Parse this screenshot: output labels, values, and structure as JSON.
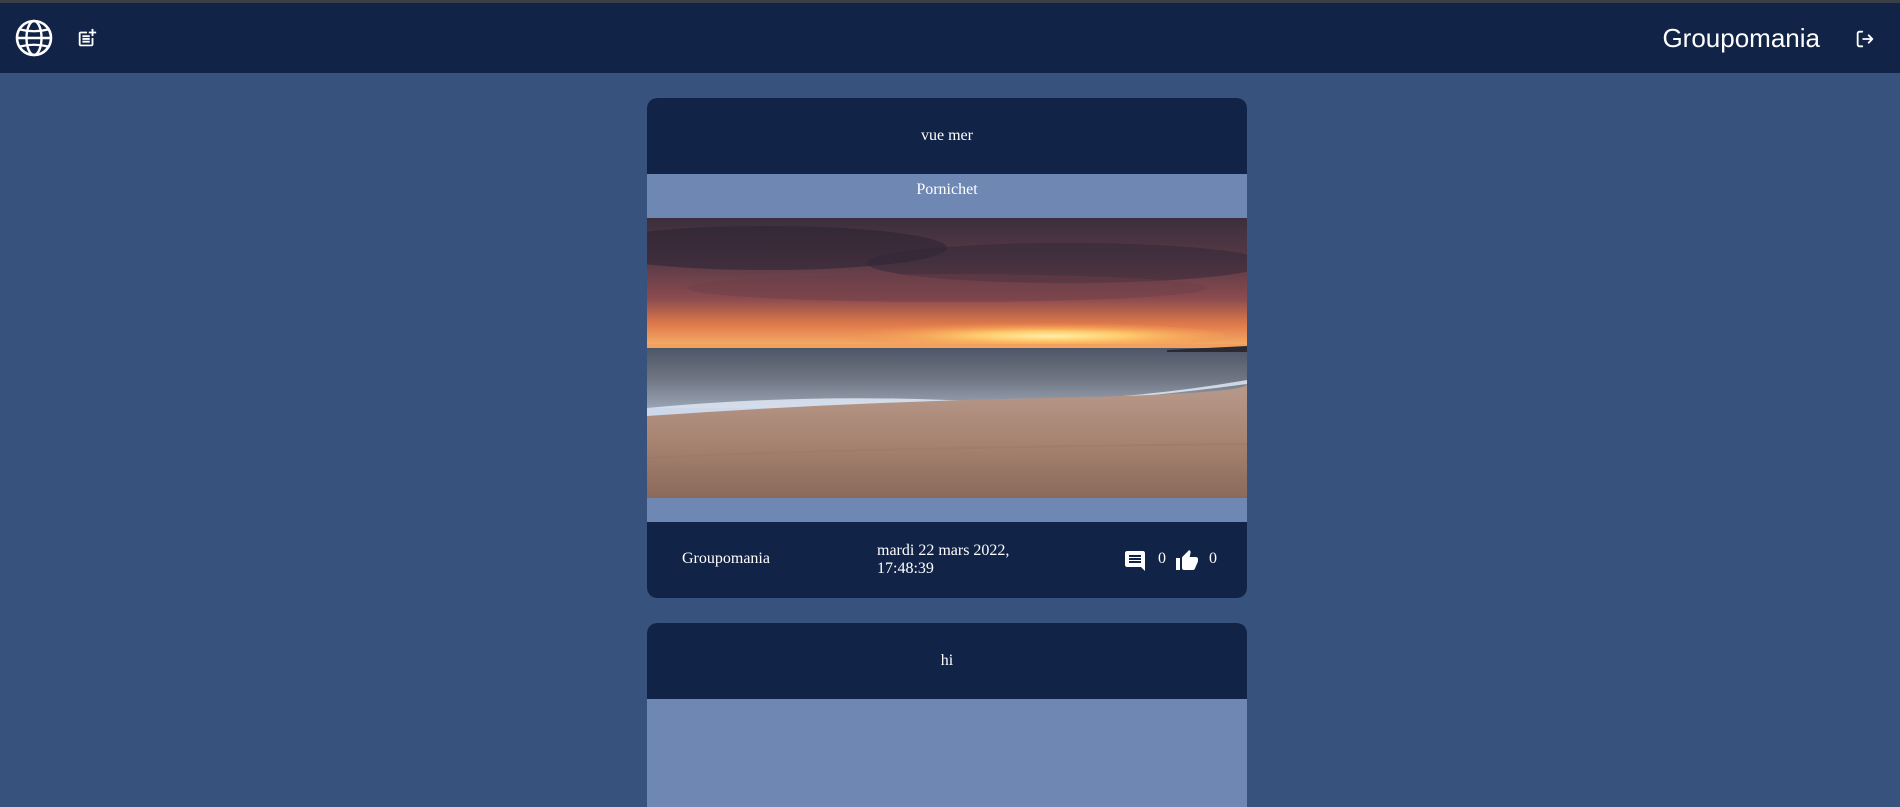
{
  "navbar": {
    "home_icon": "globe-icon",
    "new_post_icon": "post-add-icon",
    "brand": "Groupomania",
    "logout_icon": "logout-icon"
  },
  "posts": [
    {
      "title": "vue mer",
      "description": "Pornichet",
      "image": "sunset-beach-photo",
      "author": "Groupomania",
      "date": "mardi 22 mars 2022, 17:48:39",
      "comment_icon": "comment-icon",
      "comments": "0",
      "like_icon": "thumb-up-icon",
      "likes": "0"
    },
    {
      "title": "hi"
    }
  ],
  "colors": {
    "background": "#37527d",
    "navbar": "#112347",
    "card_body": "#6e88b3",
    "text": "#ffffff"
  }
}
